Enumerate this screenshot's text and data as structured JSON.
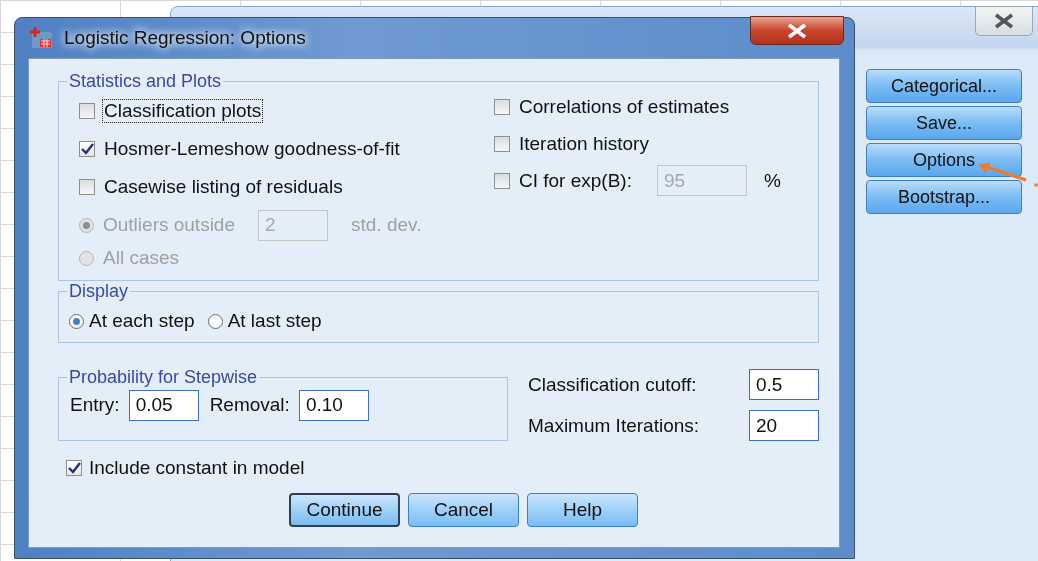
{
  "background_dialog": {
    "buttons": [
      {
        "label": "Categorical..."
      },
      {
        "label": "Save..."
      },
      {
        "label": "Options"
      },
      {
        "label": "Bootstrap..."
      }
    ]
  },
  "dialog": {
    "title": "Logistic Regression: Options",
    "statistics_and_plots": {
      "title": "Statistics and Plots",
      "left_checkboxes": [
        {
          "label": "Classification plots",
          "checked": false,
          "focused": true
        },
        {
          "label": "Hosmer-Lemeshow goodness-of-fit",
          "checked": true,
          "focused": false
        },
        {
          "label": "Casewise listing of residuals",
          "checked": false,
          "focused": false
        }
      ],
      "residual_options": [
        {
          "label": "Outliers outside",
          "selected": true,
          "disabled": true,
          "value": "2",
          "suffix": "std. dev."
        },
        {
          "label": "All cases",
          "selected": false,
          "disabled": true
        }
      ],
      "right_checkboxes": [
        {
          "label": "Correlations of estimates",
          "checked": false
        },
        {
          "label": "Iteration history",
          "checked": false
        },
        {
          "label": "CI for exp(B):",
          "checked": false,
          "value": "95",
          "value_disabled": true,
          "suffix": "%"
        }
      ]
    },
    "display": {
      "title": "Display",
      "options": [
        {
          "label": "At each step",
          "selected": true
        },
        {
          "label": "At last step",
          "selected": false
        }
      ]
    },
    "probability": {
      "title": "Probability for Stepwise",
      "fields": [
        {
          "label": "Entry:",
          "value": "0.05"
        },
        {
          "label": "Removal:",
          "value": "0.10"
        }
      ]
    },
    "cutoffs": [
      {
        "label": "Classification cutoff:",
        "value": "0.5"
      },
      {
        "label": "Maximum Iterations:",
        "value": "20"
      }
    ],
    "include_constant": {
      "label": "Include constant in model",
      "checked": true
    },
    "buttons": [
      {
        "label": "Continue",
        "default": true
      },
      {
        "label": "Cancel",
        "default": false
      },
      {
        "label": "Help",
        "default": false
      }
    ]
  }
}
